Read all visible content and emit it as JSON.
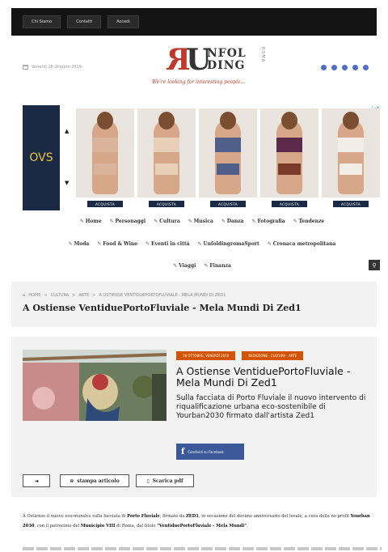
{
  "topnav": [
    "Chi Siamo",
    "Contatti",
    "Accedi"
  ],
  "header": {
    "date": "Venerdì 18 Ottobre 2019",
    "logo_lines": [
      "NFOL",
      "DING"
    ],
    "logo_roma": "ROMA",
    "tagline": "We're looking for interesting people...",
    "social_icons": [
      "facebook-icon",
      "twitter-icon",
      "instagram-icon",
      "youtube-icon",
      "rss-icon"
    ]
  },
  "ad": {
    "brand": "OVS",
    "buy_label": "ACQUISTA",
    "info_icon": "adchoices-icon",
    "products": [
      {
        "top": "#d9b49a",
        "bottom": "#d9b49a"
      },
      {
        "top": "#e8d0b8",
        "bottom": "#e8d0b8"
      },
      {
        "top": "#4f5f8a",
        "bottom": "#4f5f8a"
      },
      {
        "top": "#5b2a4a",
        "bottom": "#7a3a2a"
      },
      {
        "top": "#f2ede6",
        "bottom": "#f2ede6"
      }
    ]
  },
  "nav": {
    "row1": [
      "Home",
      "Personaggi",
      "Cultura",
      "Musica",
      "Danza",
      "Fotografia",
      "Tendenze"
    ],
    "row2": [
      "Moda",
      "Food & Wine",
      "Eventi in città",
      "UnfoldingromaSport",
      "Cronaca metropolitana"
    ],
    "row3": [
      "Viaggi",
      "Finanza"
    ]
  },
  "breadcrumb": [
    "HOME",
    "CULTURA",
    "ARTE",
    "A OSTIENSE VENTIDUEPORTOFLUVIALE - MELA MUNDI DI ZED1"
  ],
  "page_title": "A Ostiense VentiduePortoFluviale - Mela Mundi Di Zed1",
  "article": {
    "tags": [
      "18 OTTOBRE, VENERDÌ 2019",
      "REDAZIONE - CULTURA - ARTE"
    ],
    "title": "A Ostiense VentiduePortoFluviale - Mela Mundi Di Zed1",
    "subtitle": "Sulla facciata di Porto Fluviale il nuovo intervento di riqualificazione urbana eco-sostenibile di Yourban2030 firmato dall'artista Zed1",
    "fb_label": "Condividi su Facebook",
    "tools": {
      "back": "◄",
      "print": "stampa articolo",
      "pdf": "Scarica pdf"
    }
  },
  "body": {
    "p1": "A Ostiense il nuovo eco-murales sulla facciata di",
    "b1": "Porto Fluviale",
    "p2": ", firmato da",
    "b2": "ZED1",
    "p3": ", in occasione del decimo anniversario del locale, a cura della no profit",
    "b3": "Yourban 2030",
    "p4": ", con il patrocinio del",
    "b4": "Municipio VIII",
    "p5": "di Roma, dal titolo",
    "b5": "\"VentiduePortoFluviale - Mela Mundi\"",
    "p6": "."
  },
  "colors": {
    "accent": "#d35400",
    "logo_red": "#c0392b",
    "facebook": "#3b5998",
    "ad_brand": "#1a2a44"
  }
}
